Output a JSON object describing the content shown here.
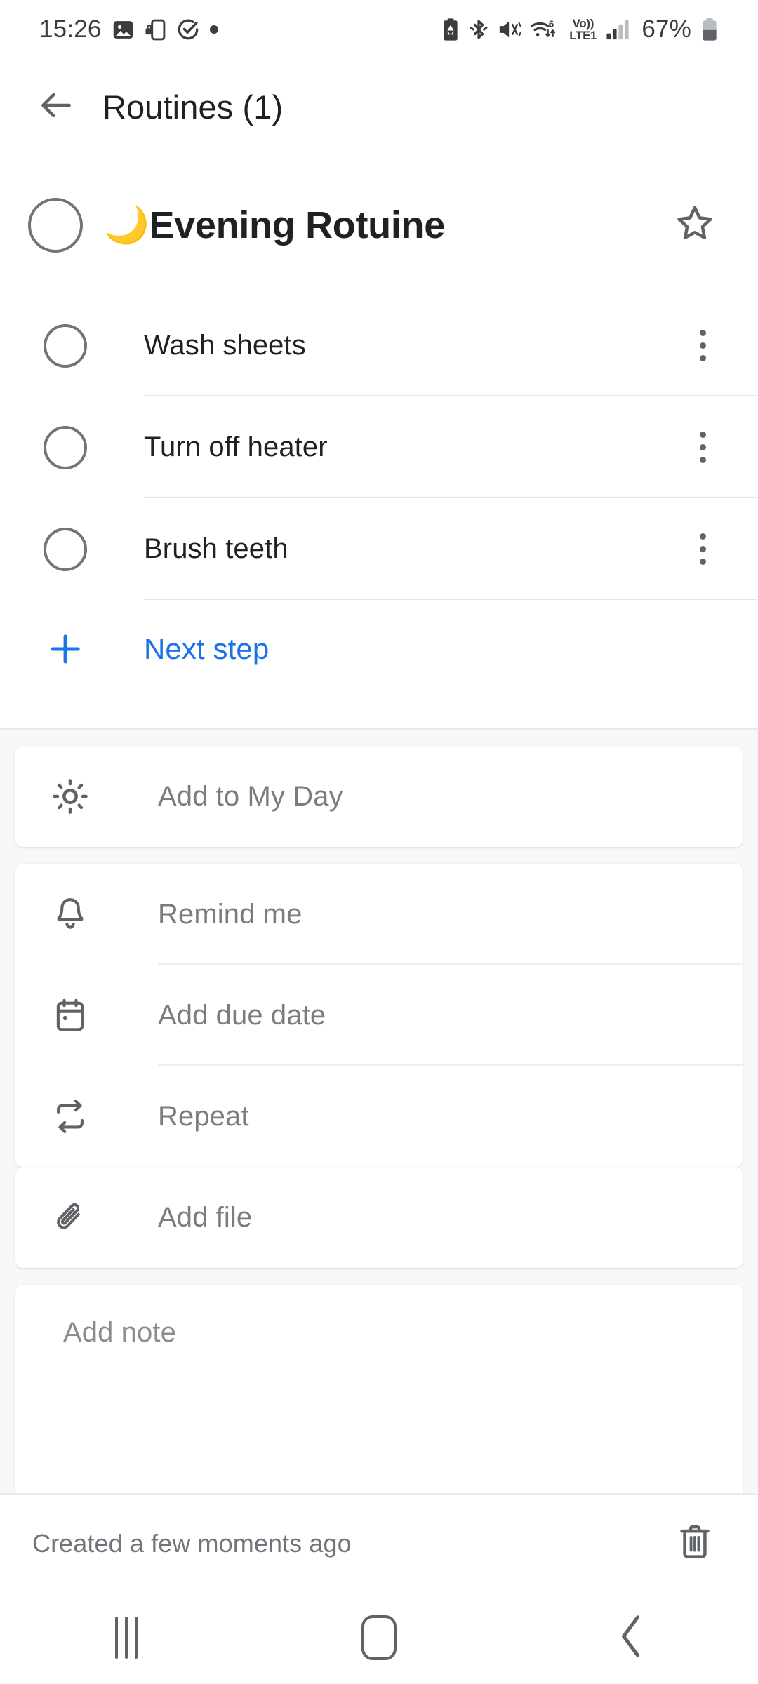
{
  "status_bar": {
    "time": "15:26",
    "left_icons": [
      "photo-icon",
      "phone-lock-icon",
      "check-circle-icon",
      "dot-indicator-icon"
    ],
    "right_icons": [
      "battery-saver-icon",
      "bluetooth-icon",
      "volume-mute-icon",
      "wifi-icon",
      "volte-icon",
      "signal-bars-icon"
    ],
    "wifi_generation": "6",
    "volte_top": "Vo))",
    "volte_bottom": "LTE1",
    "battery_percent": "67%"
  },
  "header": {
    "back_icon": "arrow-left-icon",
    "title": "Routines (1)"
  },
  "task": {
    "checkbox_state": "unchecked",
    "emoji": "🌙",
    "title": "Evening Rotuine",
    "star_icon": "star-outline-icon",
    "starred": false
  },
  "steps": {
    "menu_icon": "more-vertical-icon",
    "items": [
      {
        "label": "Wash sheets",
        "checked": false
      },
      {
        "label": "Turn off heater",
        "checked": false
      },
      {
        "label": "Brush teeth",
        "checked": false
      }
    ],
    "next_step": {
      "label": "Next step",
      "icon": "plus-icon"
    }
  },
  "actions": {
    "groups": [
      {
        "rows": [
          {
            "label": "Add to My Day",
            "icon": "sun-icon"
          }
        ]
      },
      {
        "rows": [
          {
            "label": "Remind me",
            "icon": "bell-icon"
          },
          {
            "label": "Add due date",
            "icon": "calendar-icon"
          },
          {
            "label": "Repeat",
            "icon": "repeat-icon"
          }
        ]
      },
      {
        "rows": [
          {
            "label": "Add file",
            "icon": "paperclip-icon"
          }
        ]
      }
    ]
  },
  "note": {
    "placeholder": "Add note",
    "value": ""
  },
  "footer": {
    "created_text": "Created a few moments ago",
    "delete_icon": "trash-icon"
  },
  "nav_bar": {
    "recents": "recents-icon",
    "home": "home-icon",
    "back": "back-chevron-icon"
  },
  "colors": {
    "accent_blue": "#1a73e8",
    "text_primary": "#202124",
    "text_secondary": "#7a7d80",
    "moon_yellow": "#f5b822",
    "page_bg": "#ffffff",
    "section_bg": "#f7f8f8"
  }
}
